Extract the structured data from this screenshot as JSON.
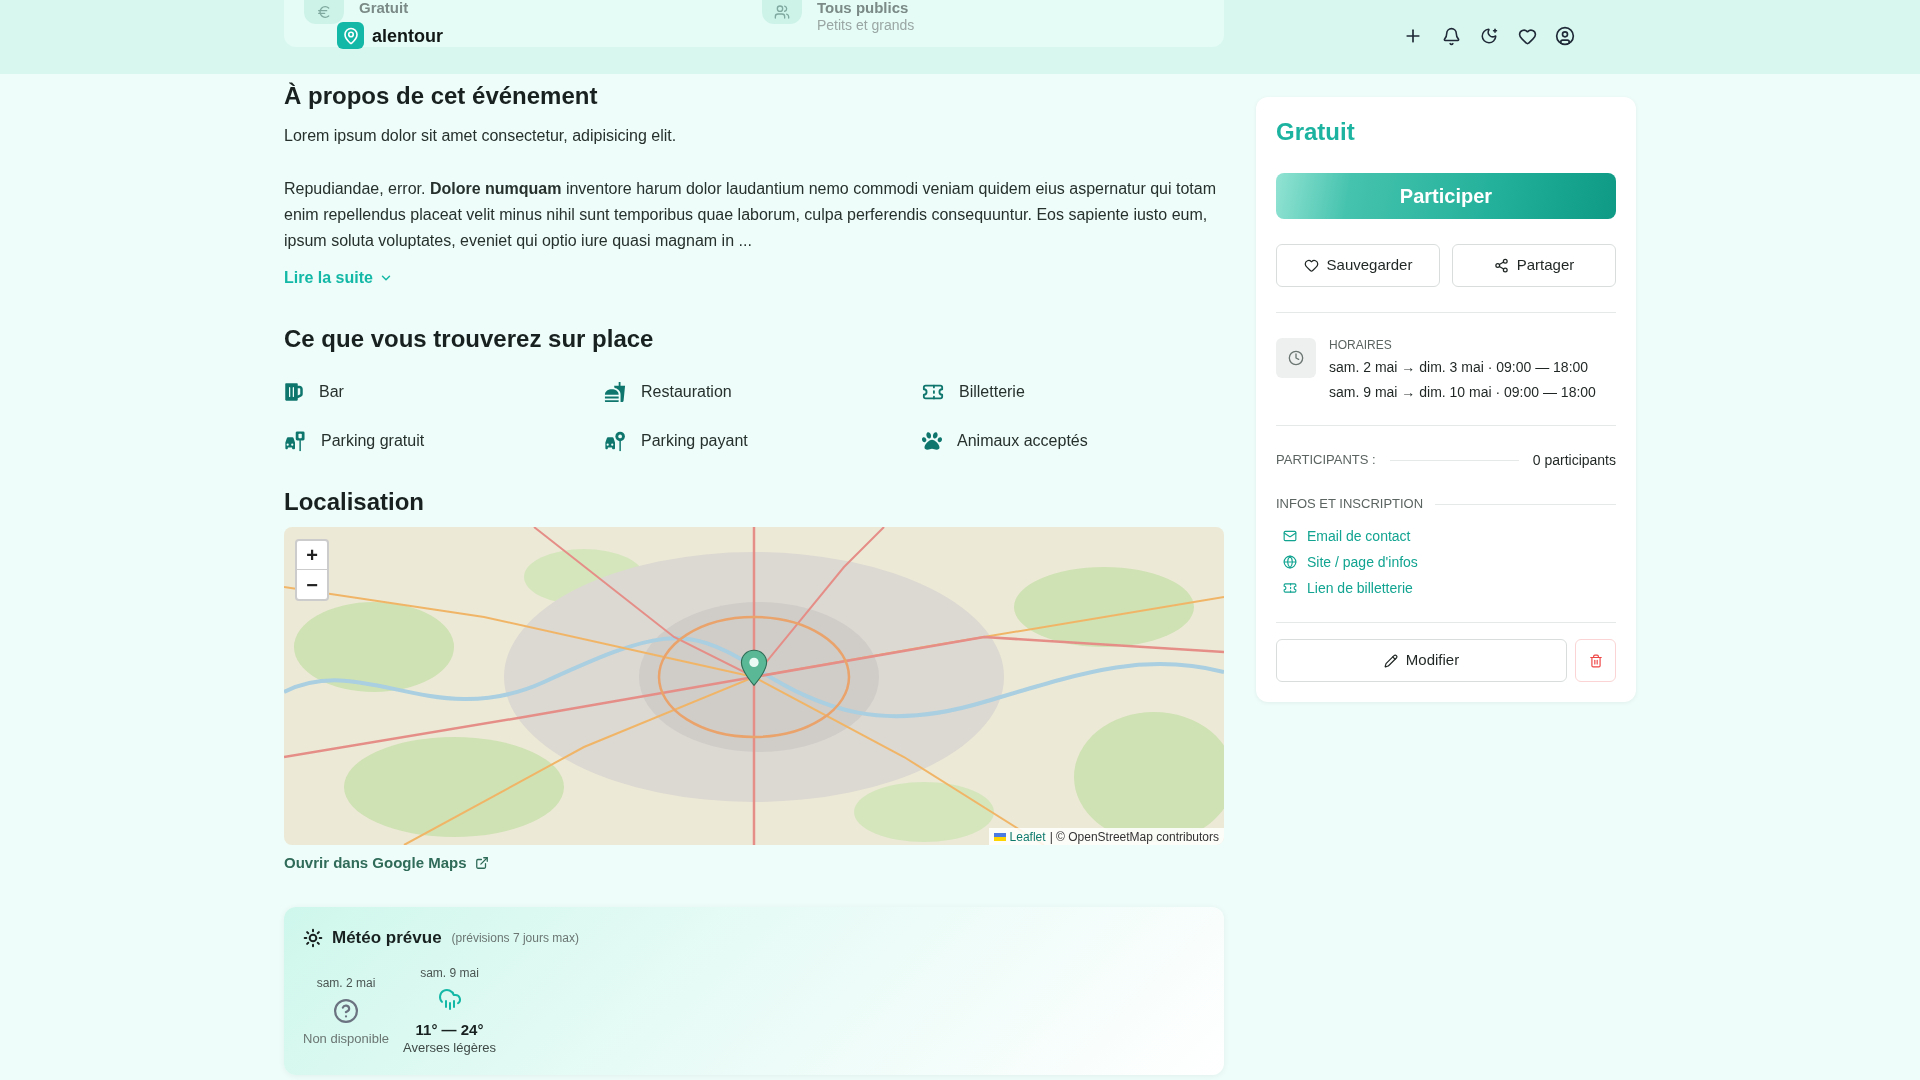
{
  "header": {
    "summary": [
      {
        "kind": "price",
        "title": "Gratuit"
      },
      {
        "kind": "audience",
        "title": "Tous publics",
        "subtitle": "Petits et grands"
      }
    ],
    "brand": "alentour"
  },
  "about": {
    "title": "À propos de cet événement",
    "paragraphs": [
      "Lorem ipsum dolor sit amet consectetur, adipisicing elit.",
      "Repudiandae, error. **Dolore numquam** inventore harum dolor laudantium nemo commodi veniam quidem eius aspernatur qui totam enim repellendus placeat velit minus nihil sunt temporibus quae laborum, culpa perferendis consequuntur. Eos sapiente iusto eum, ipsum soluta voluptates, eveniet qui optio iure quasi magnam in ..."
    ],
    "read_more": "Lire la suite"
  },
  "amenities": {
    "title": "Ce que vous trouverez sur place",
    "items": [
      {
        "kind": "bar",
        "label": "Bar"
      },
      {
        "kind": "food",
        "label": "Restauration"
      },
      {
        "kind": "ticket",
        "label": "Billetterie"
      },
      {
        "kind": "free_parking",
        "label": "Parking gratuit"
      },
      {
        "kind": "paid_parking",
        "label": "Parking payant"
      },
      {
        "kind": "pets",
        "label": "Animaux acceptés"
      }
    ]
  },
  "location": {
    "title": "Localisation",
    "map": {
      "zoom_in": "+",
      "zoom_out": "−",
      "attribution_link": "Leaflet",
      "attribution": "| © OpenStreetMap contributors"
    },
    "external_link": "Ouvrir dans Google Maps"
  },
  "weather": {
    "title": "Météo prévue",
    "note": "(prévisions 7 jours max)",
    "days": [
      {
        "kind": "unavailable",
        "date": "sam. 2 mai",
        "status": "Non disponible"
      },
      {
        "kind": "rain",
        "date": "sam. 9 mai",
        "temperature": "11° — 24°",
        "status": "Averses légères"
      }
    ]
  },
  "sidebar": {
    "price": "Gratuit",
    "primary_button": "Participer",
    "actions": [
      {
        "kind": "save",
        "label": "Sauvegarder"
      },
      {
        "kind": "share",
        "label": "Partager"
      }
    ],
    "schedule": {
      "label": "HORAIRES",
      "lines": [
        "sam. 2 mai → dim. 3 mai · 09:00 — 18:00",
        "sam. 9 mai → dim. 10 mai · 09:00 — 18:00"
      ]
    },
    "participants": {
      "label": "PARTICIPANTS :",
      "value": "0 participants"
    },
    "infos": {
      "label": "INFOS ET INSCRIPTION",
      "links": [
        {
          "kind": "email",
          "label": "Email de contact"
        },
        {
          "kind": "website",
          "label": "Site / page d'infos"
        },
        {
          "kind": "ticketing",
          "label": "Lien de billetterie"
        }
      ]
    },
    "edit_button": "Modifier"
  }
}
